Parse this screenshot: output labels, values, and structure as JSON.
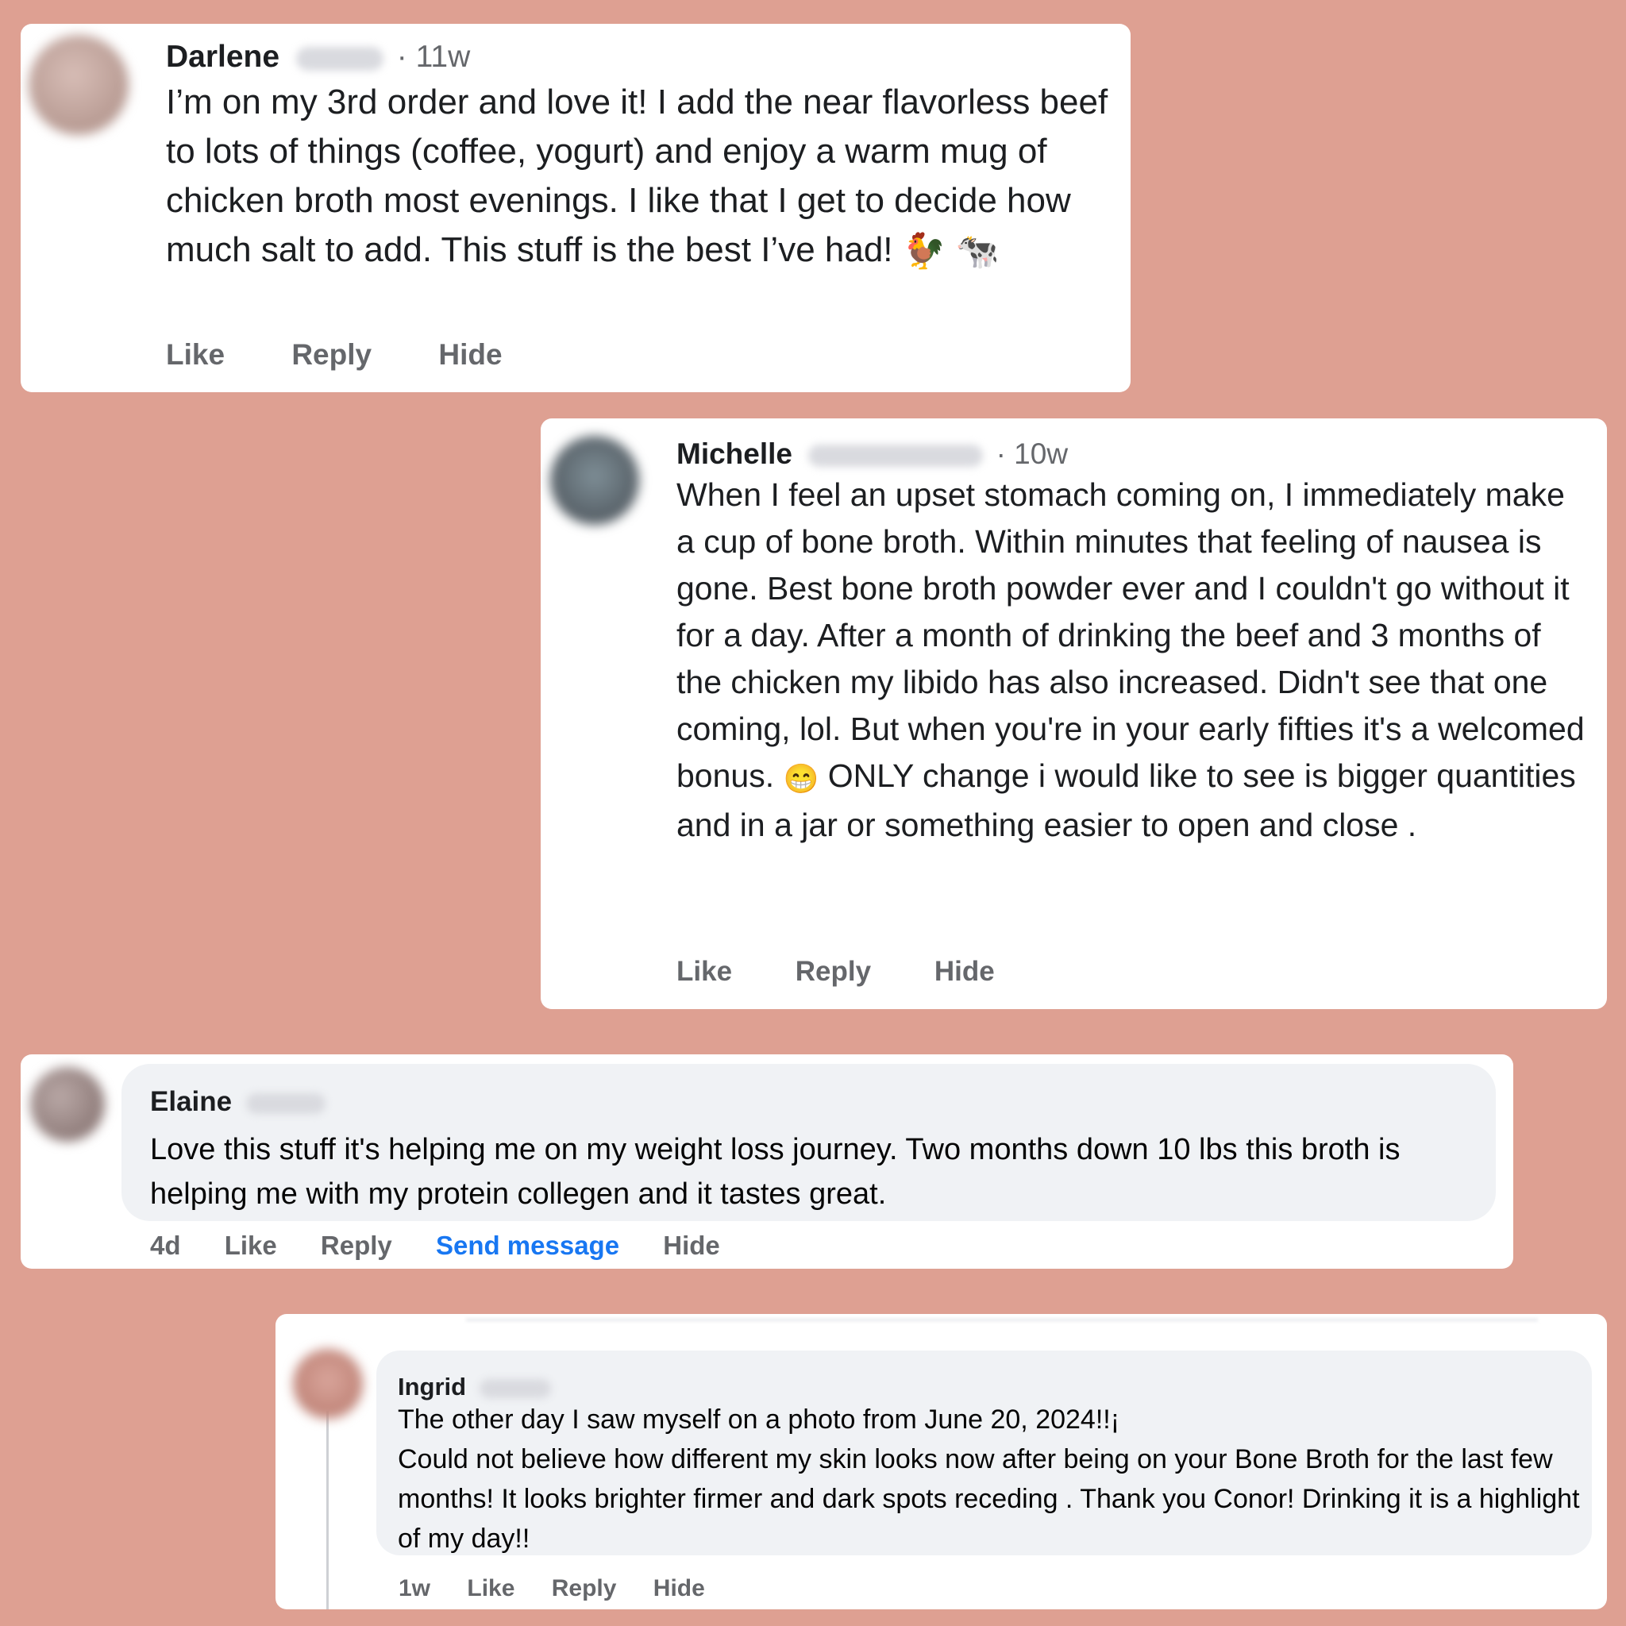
{
  "comments": [
    {
      "name": "Darlene",
      "time": "· 11w",
      "text": "I’m on my 3rd order and love it! I add the near flavorless beef to lots of things (coffee, yogurt) and enjoy a warm mug of chicken broth most evenings. I like that I get to decide how much salt to add. This stuff is the best I’ve had!",
      "emojis": [
        "🐓",
        "🐄"
      ],
      "actions": {
        "like": "Like",
        "reply": "Reply",
        "hide": "Hide"
      }
    },
    {
      "name": "Michelle",
      "time": "· 10w",
      "text_before_emoji": "When I feel an upset stomach coming on, I immediately make a cup of bone broth. Within minutes that feeling of nausea is gone. Best bone broth powder ever and I couldn't go without it for a day. After a month of drinking the beef and 3 months of the chicken my libido has also increased. Didn't see that one coming, lol. But when you're in your early fifties it's a welcomed bonus.",
      "emoji": "😁",
      "text_after_emoji": "ONLY change i would like to see is bigger quantities and in a jar or something easier to open and close .",
      "actions": {
        "like": "Like",
        "reply": "Reply",
        "hide": "Hide"
      }
    },
    {
      "name": "Elaine",
      "text": "Love this stuff it's helping me on my weight loss journey. Two months down 10 lbs this broth is helping me with my protein collegen and it tastes great.",
      "actions": {
        "time": "4d",
        "like": "Like",
        "reply": "Reply",
        "send_message": "Send message",
        "hide": "Hide"
      }
    },
    {
      "name": "Ingrid",
      "text_line1": "The other day I saw myself on a photo from June 20, 2024!!¡",
      "text_rest": "Could not believe how different my skin looks now after being on your Bone Broth for the last few months! It looks brighter firmer and dark spots receding . Thank you Conor! Drinking it is a highlight of my day!!",
      "actions": {
        "time": "1w",
        "like": "Like",
        "reply": "Reply",
        "hide": "Hide"
      }
    }
  ],
  "colors": {
    "background": "#dea092",
    "card": "#ffffff",
    "bubble": "#f0f2f5",
    "muted_text": "#65676b",
    "link_blue": "#1877f2"
  }
}
